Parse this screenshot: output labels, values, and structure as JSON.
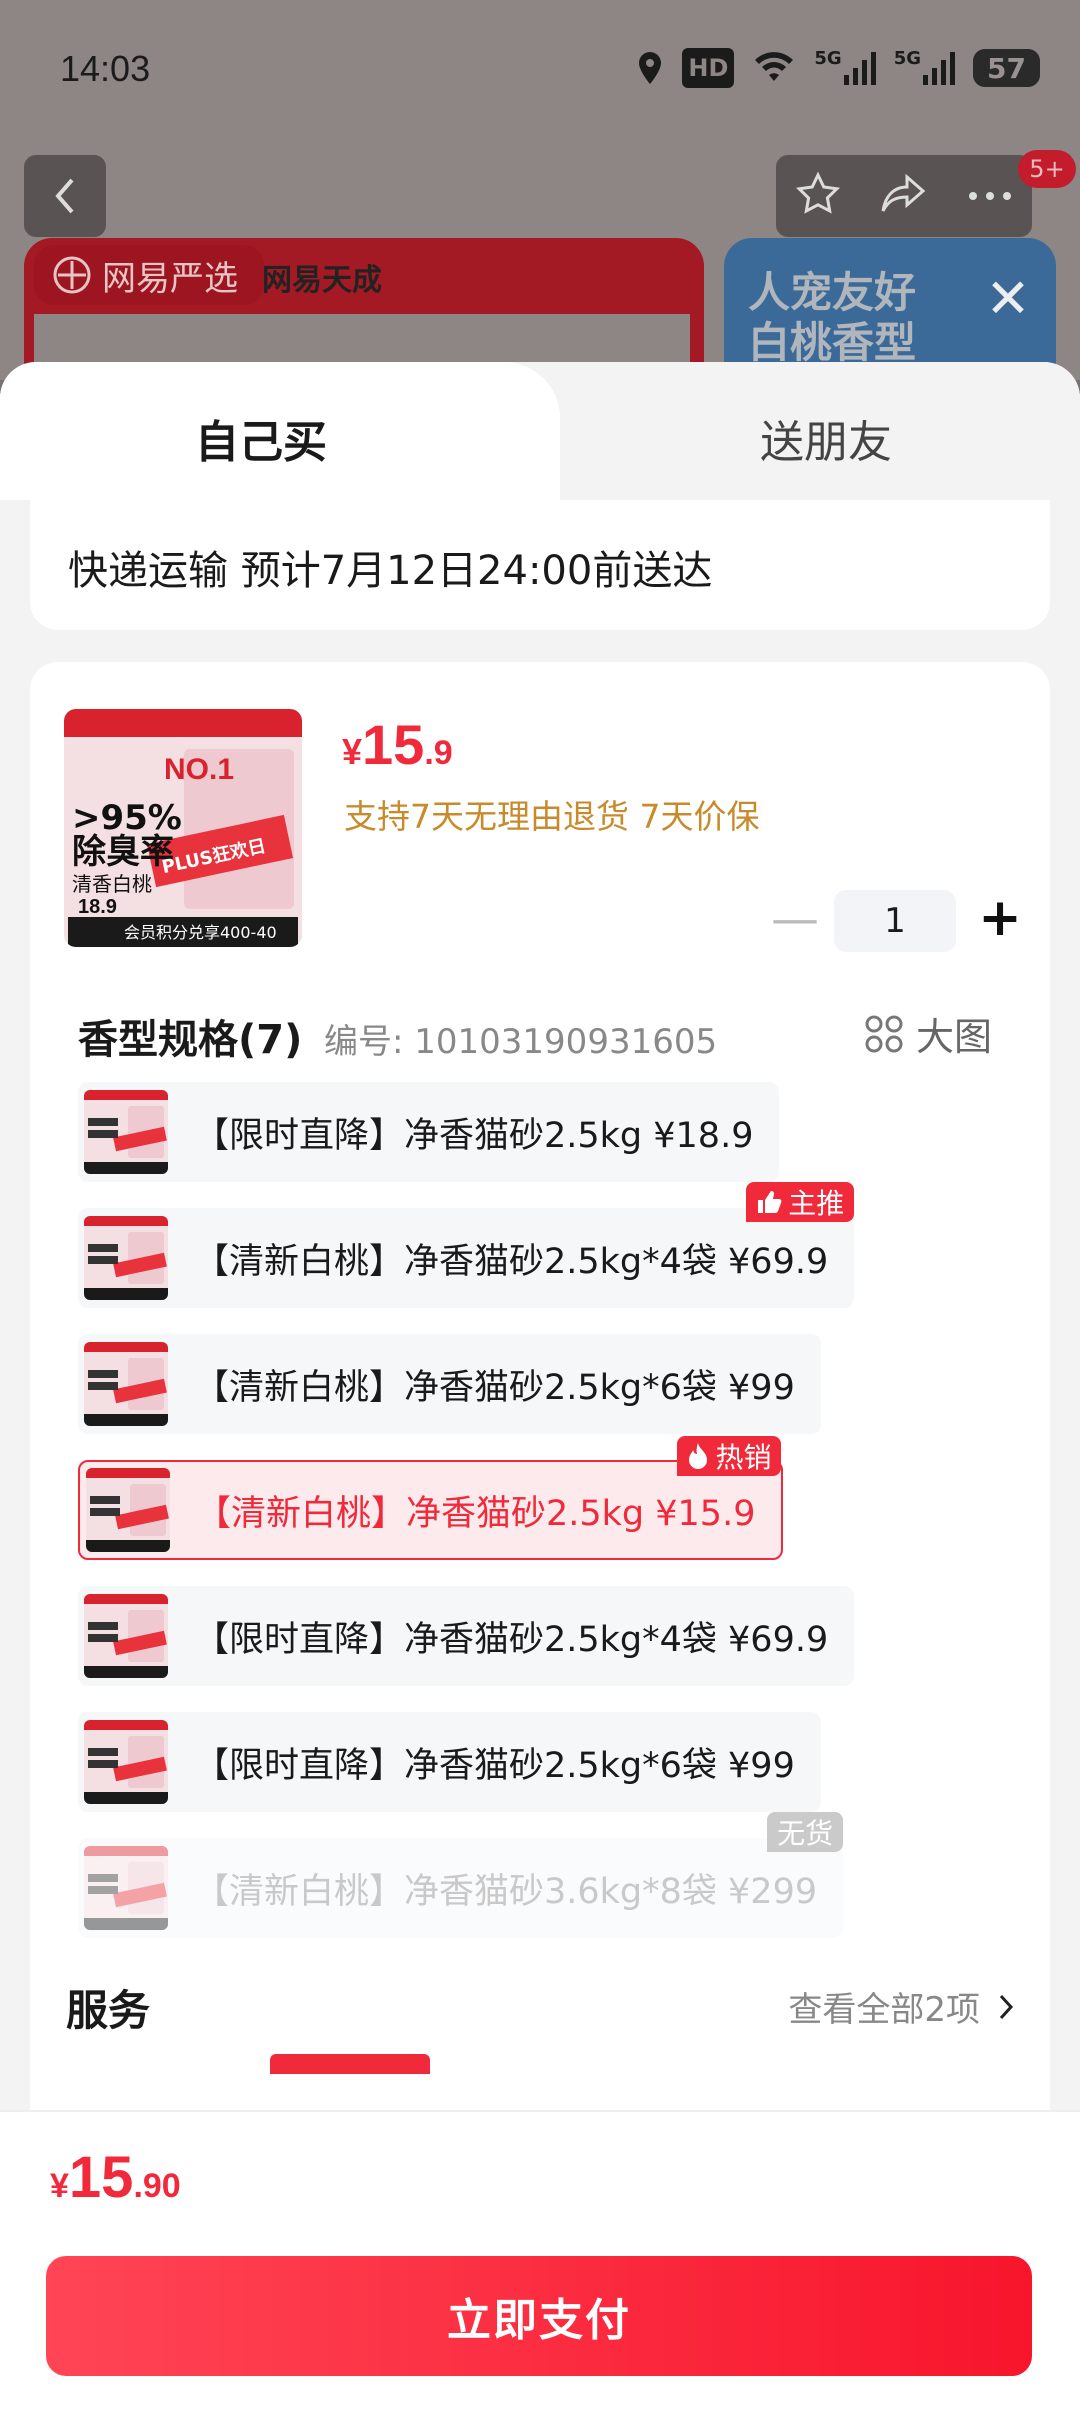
{
  "status_bar": {
    "time": "14:03",
    "icons": [
      "location-icon",
      "hd-icon",
      "wifi-icon",
      "5g-signal-icon",
      "5g-signal-icon",
      "battery-icon"
    ],
    "hd_label": "HD",
    "net_label_1": "5G",
    "net_label_2": "5G",
    "battery": "57"
  },
  "background_page": {
    "notification_badge": "5+",
    "banner_left_logo": "网易严选",
    "banner_left_brand": "网易天成",
    "banner_right_text": "人宠友好\n白桃香型"
  },
  "tabs": {
    "buy_self": "自己买",
    "gift": "送朋友"
  },
  "delivery": {
    "text": "快递运输 预计7月12日24:00前送达"
  },
  "product": {
    "price_currency": "¥",
    "price_int": "15",
    "price_dec": ".9",
    "promise": "支持7天无理由退货 7天价保",
    "quantity": "1",
    "thumb_badge": "NO.1",
    "thumb_text": ">95%\n除臭率",
    "thumb_sub": "清香白桃",
    "thumb_price": "18.9",
    "thumb_footer": "会员积分兑享400-40",
    "thumb_plus": "PLUS狂欢日"
  },
  "spec": {
    "title": "香型规格(7)",
    "code": "编号: 10103190931605",
    "big_view": "大图",
    "options": [
      {
        "label": "【限时直降】净香猫砂2.5kg  ¥18.9",
        "tag": "",
        "state": "normal"
      },
      {
        "label": "【清新白桃】净香猫砂2.5kg*4袋  ¥69.9",
        "tag": "主推",
        "state": "normal"
      },
      {
        "label": "【清新白桃】净香猫砂2.5kg*6袋  ¥99",
        "tag": "",
        "state": "normal"
      },
      {
        "label": "【清新白桃】净香猫砂2.5kg  ¥15.9",
        "tag": "热销",
        "state": "selected"
      },
      {
        "label": "【限时直降】净香猫砂2.5kg*4袋  ¥69.9",
        "tag": "",
        "state": "normal"
      },
      {
        "label": "【限时直降】净香猫砂2.5kg*6袋  ¥99",
        "tag": "",
        "state": "normal"
      },
      {
        "label": "【清新白桃】净香猫砂3.6kg*8袋  ¥299",
        "tag": "无货",
        "state": "disabled"
      }
    ]
  },
  "service": {
    "title": "服务",
    "view_all": "查看全部2项"
  },
  "bottom": {
    "price_currency": "¥",
    "price_int": "15",
    "price_dec": ".90",
    "pay_label": "立即支付"
  },
  "colors": {
    "accent": "#f02a3b",
    "promise": "#c88a2a"
  }
}
